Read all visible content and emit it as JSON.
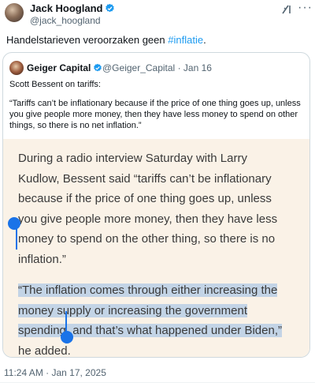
{
  "tweet": {
    "author_name": "Jack Hoogland",
    "author_handle": "@jack_hoogland",
    "text_before": "Handelstarieven veroorzaken geen ",
    "hashtag": "#inflatie",
    "text_after": ".",
    "timestamp": "11:24 AM · Jan 17, 2025",
    "icons": {
      "verified": "verified-badge-icon",
      "grok": "grok-icon",
      "more": "more-options-icon"
    }
  },
  "quoted_tweet": {
    "author_name": "Geiger Capital",
    "author_handle": "@Geiger_Capital",
    "date": "· Jan 16",
    "line1": "Scott Bessent on tariffs:",
    "quote_lines": [
      "“Tariffs can’t be inflationary because if the price of one thing goes up, unless",
      "you give people more money, then they have less money to spend on other",
      "things, so there is no net inflation.”"
    ],
    "article": {
      "para1_lines": [
        "During a radio interview Saturday with Larry",
        "Kudlow, Bessent said “tariffs can’t be inflationary",
        "because if the price of one thing goes up, unless",
        "you give people more money, then they have less",
        "money to spend on the other thing, so there is no",
        "inflation.”"
      ],
      "para2_highlight_lines": [
        "“The inflation comes through either increasing the",
        "money supply or increasing the government",
        "spending,"
      ],
      "para2_rest_line3": " and that’s what happened under Biden,”",
      "para2_line4": "he added."
    }
  },
  "colors": {
    "accent": "#1d9bf0",
    "selection_handle": "#1a73e8",
    "highlight": "#c3d4e6",
    "article_bg": "#faf2e7"
  }
}
